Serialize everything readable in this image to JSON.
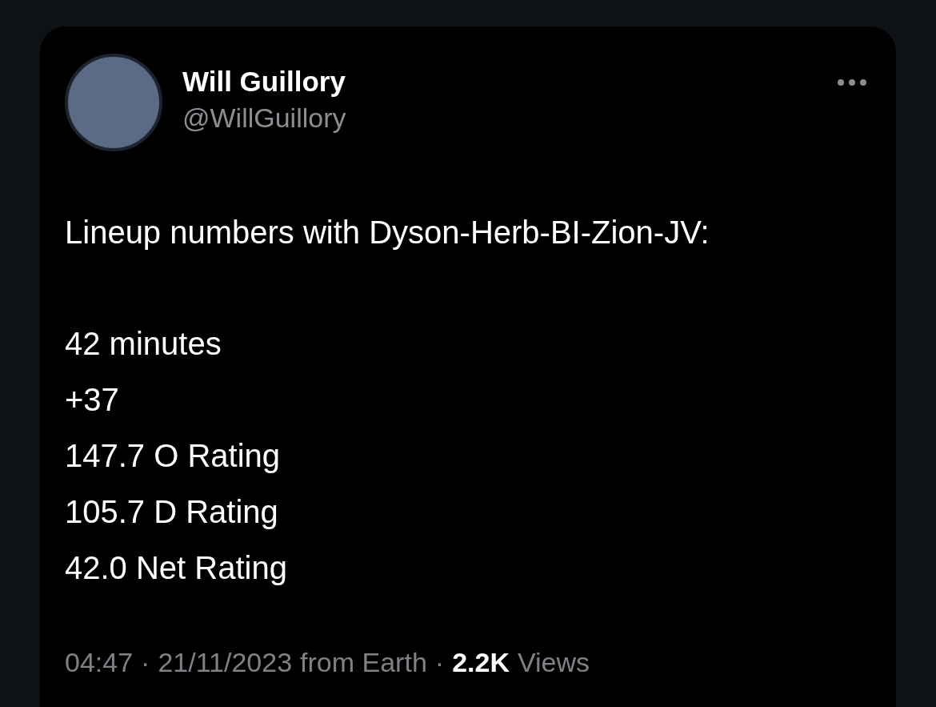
{
  "post": {
    "author": {
      "name": "Will Guillory",
      "handle": "@WillGuillory"
    },
    "intro": "Lineup numbers with Dyson-Herb-BI-Zion-JV:",
    "stats": [
      "42 minutes",
      "+37",
      "147.7 O Rating",
      "105.7 D Rating",
      "42.0 Net Rating"
    ],
    "footer": {
      "time": "04:47",
      "separator_1": "·",
      "separator_2": "·",
      "date": "21/11/2023",
      "source": "from Earth",
      "views_count": "2.2K",
      "views_label": "Views"
    }
  }
}
